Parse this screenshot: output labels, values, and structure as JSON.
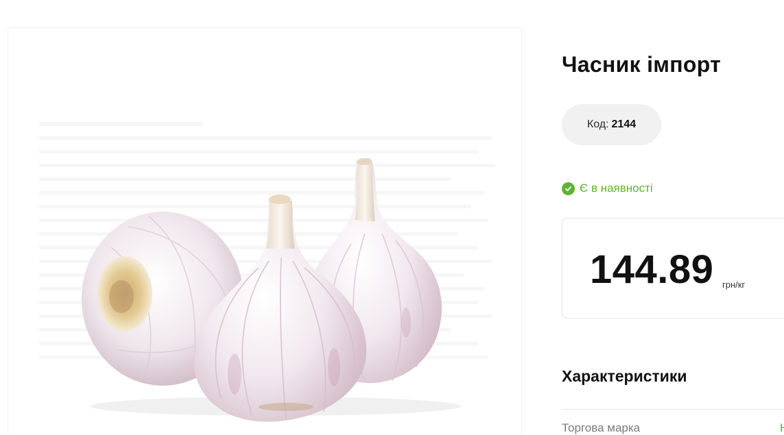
{
  "product": {
    "title": "Часник імпорт",
    "code_label": "Код:",
    "code_value": "2144",
    "stock_status": "Є в наявності",
    "price": "144.89",
    "price_unit": "грн/кг",
    "image_icon": "garlic-product-photo"
  },
  "characteristics": {
    "heading": "Характеристики",
    "rows": [
      {
        "label": "Торгова марка",
        "value": "Н"
      }
    ]
  },
  "colors": {
    "accent_green": "#5fb332",
    "pill_background": "#f1f1f1",
    "text_dark": "#121212"
  }
}
